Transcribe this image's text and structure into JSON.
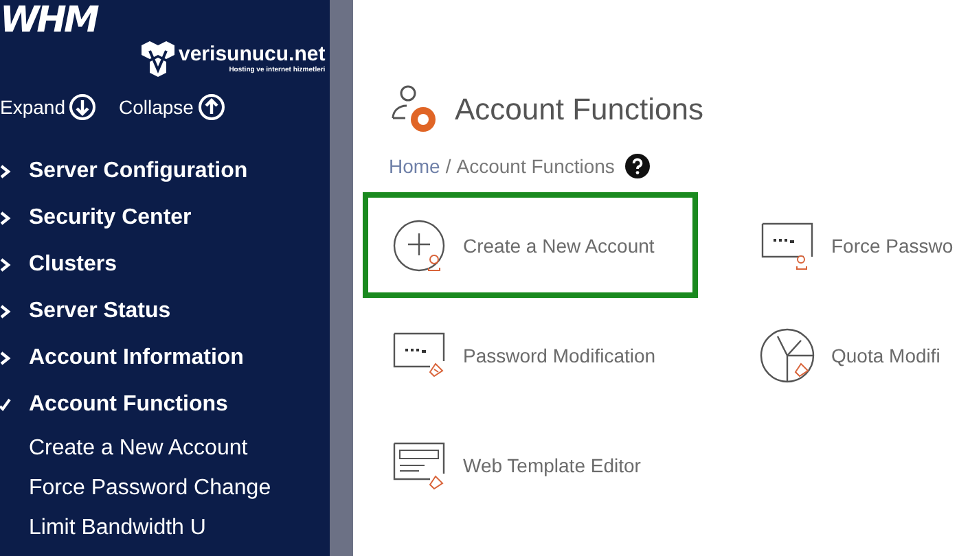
{
  "sidebar": {
    "logo": "WHM",
    "brand": {
      "name": "verisunucu.net",
      "tagline": "Hosting ve internet hizmetleri"
    },
    "controls": [
      {
        "label": "Expand",
        "kind": "expand"
      },
      {
        "label": "Collapse",
        "kind": "collapse"
      }
    ],
    "items": [
      {
        "label": "Server Configuration",
        "expanded": false
      },
      {
        "label": "Security Center",
        "expanded": false
      },
      {
        "label": "Clusters",
        "expanded": false
      },
      {
        "label": "Server Status",
        "expanded": false
      },
      {
        "label": "Account Information",
        "expanded": false
      },
      {
        "label": "Account Functions",
        "expanded": true,
        "children": [
          {
            "label": "Create a New Account"
          },
          {
            "label": "Force Password Change"
          },
          {
            "label": "Limit Bandwidth U"
          }
        ]
      }
    ]
  },
  "page": {
    "title": "Account Functions",
    "breadcrumb": [
      {
        "label": "Home",
        "kind": "link"
      },
      {
        "label": "/",
        "kind": "separator"
      },
      {
        "label": "Account Functions",
        "kind": "current"
      }
    ],
    "features": [
      {
        "label": "Create a New Account",
        "kind": "add-user",
        "selected": true
      },
      {
        "label": "Force Passwo",
        "kind": "password",
        "selected": false
      },
      {
        "label": "Password Modification",
        "kind": "password-edit",
        "selected": false
      },
      {
        "label": "Quota Modifi",
        "kind": "quota",
        "selected": false
      },
      {
        "label": "Web Template Editor",
        "kind": "template",
        "selected": false
      }
    ]
  }
}
